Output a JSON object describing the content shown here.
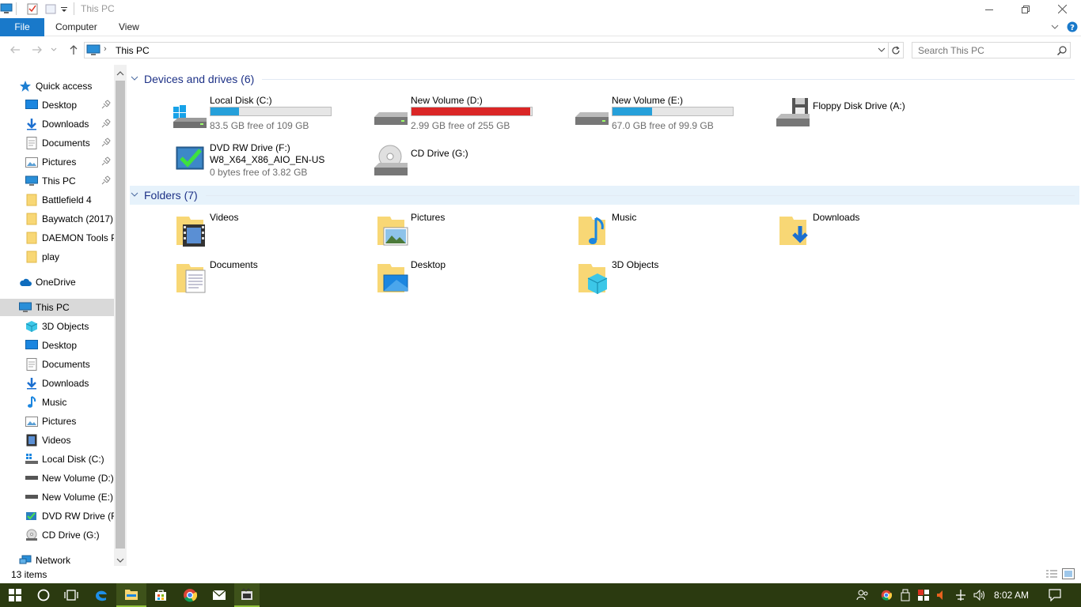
{
  "window": {
    "title": "This PC"
  },
  "ribbon": {
    "tabs": [
      "File",
      "Computer",
      "View"
    ]
  },
  "address": {
    "path": "This PC",
    "search_placeholder": "Search This PC"
  },
  "navpane": {
    "quick_access": "Quick access",
    "quick_items": [
      "Desktop",
      "Downloads",
      "Documents",
      "Pictures",
      "This PC",
      "Battlefield 4",
      "Baywatch (2017) ",
      "DAEMON Tools P",
      "play"
    ],
    "onedrive": "OneDrive",
    "this_pc": "This PC",
    "pc_items": [
      "3D Objects",
      "Desktop",
      "Documents",
      "Downloads",
      "Music",
      "Pictures",
      "Videos",
      "Local Disk (C:)",
      "New Volume (D:)",
      "New Volume (E:)",
      "DVD RW Drive (F:",
      "CD Drive (G:)"
    ],
    "network": "Network"
  },
  "devices": {
    "header": "Devices and drives (6)",
    "drives": [
      {
        "name": "Local Disk (C:)",
        "free": "83.5 GB free of 109 GB",
        "used_fraction": 0.234,
        "bar_color": "#26a0da"
      },
      {
        "name": "New Volume (D:)",
        "free": "2.99 GB free of 255 GB",
        "used_fraction": 0.988,
        "bar_color": "#da2626"
      },
      {
        "name": "New Volume (E:)",
        "free": "67.0 GB free of 99.9 GB",
        "used_fraction": 0.329,
        "bar_color": "#26a0da"
      },
      {
        "name": "Floppy Disk Drive (A:)"
      },
      {
        "name": "DVD RW Drive (F:)",
        "label": "W8_X64_X86_AIO_EN-US",
        "free": "0 bytes free of 3.82 GB"
      },
      {
        "name": "CD Drive (G:)"
      }
    ]
  },
  "folders": {
    "header": "Folders (7)",
    "items": [
      "Videos",
      "Pictures",
      "Music",
      "Downloads",
      "Documents",
      "Desktop",
      "3D Objects"
    ]
  },
  "status": {
    "items_count": "13 items"
  },
  "taskbar": {
    "clock": "8:02 AM"
  }
}
